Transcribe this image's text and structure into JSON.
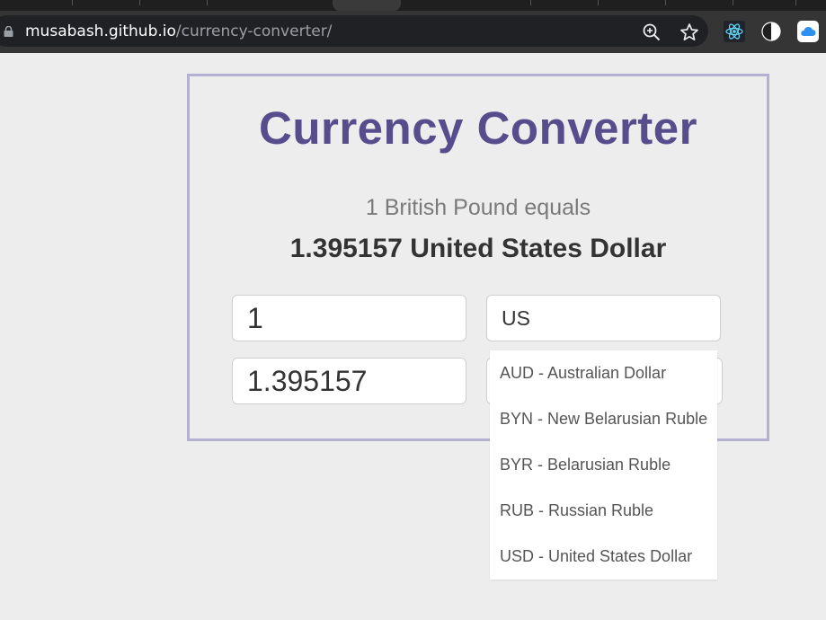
{
  "browser": {
    "url_host": "musabash.github.io",
    "url_path": "/currency-converter/",
    "icons": [
      "lock-icon",
      "zoom-icon",
      "star-icon",
      "react-icon",
      "contrast-icon",
      "cloud-icon"
    ]
  },
  "converter": {
    "title": "Currency Converter",
    "rate_text": "1 British Pound equals",
    "result_text": "1.395157 United States Dollar",
    "amount_value": "1",
    "from_search_value": "US",
    "converted_value": "1.395157"
  },
  "dropdown": {
    "options": [
      "AUD - Australian Dollar",
      "BYN - New Belarusian Ruble",
      "BYR - Belarusian Ruble",
      "RUB - Russian Ruble",
      "USD - United States Dollar"
    ]
  },
  "colors": {
    "title": "#574d8c",
    "card_border": "#b3b0d2",
    "page_bg": "#ededed"
  }
}
